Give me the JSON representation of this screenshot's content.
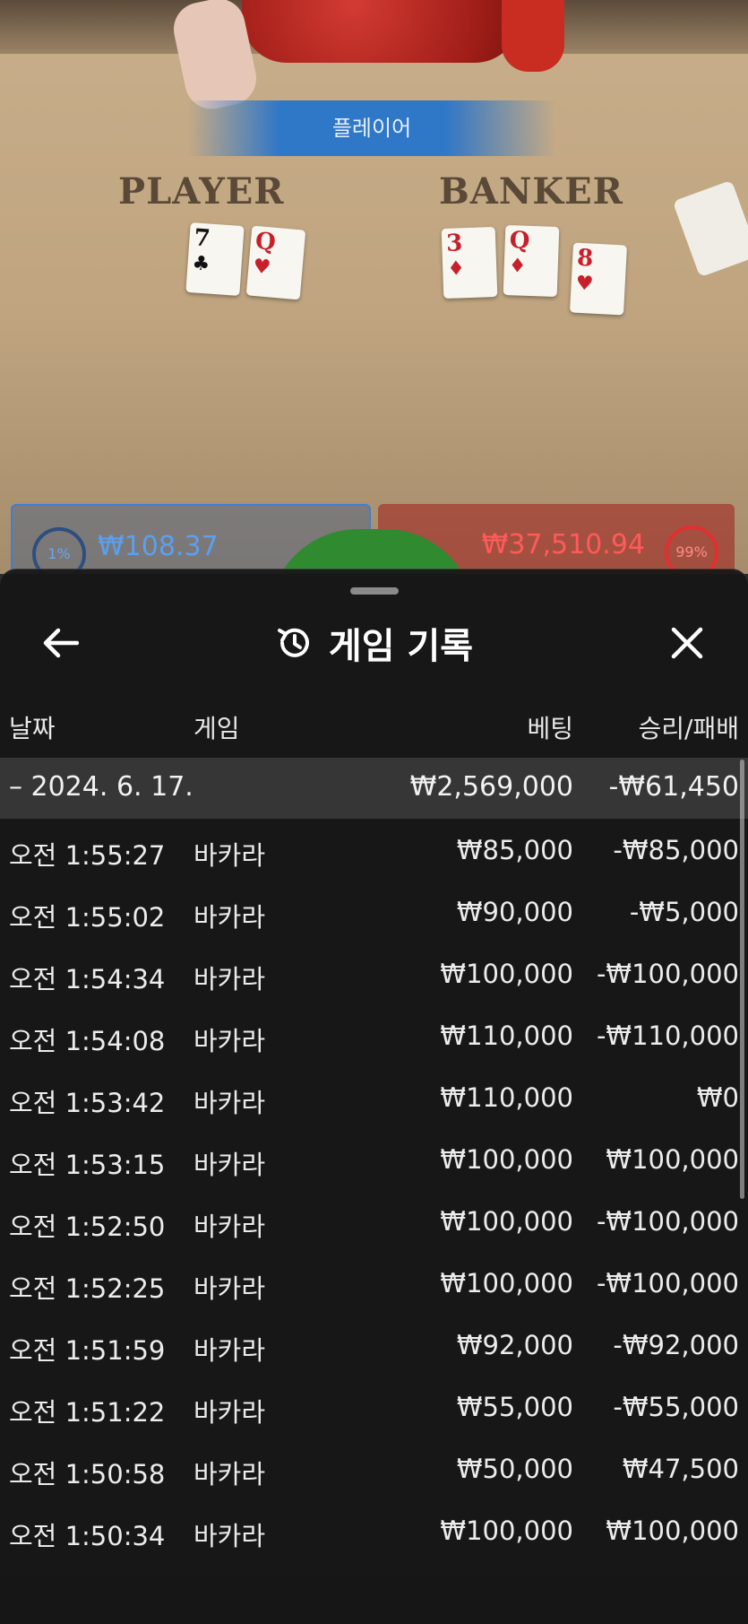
{
  "game_view": {
    "announcement": "플레이어",
    "player_label": "PLAYER",
    "banker_label": "BANKER",
    "player_cards": [
      {
        "rank": "7",
        "suit": "♣",
        "color": "black"
      },
      {
        "rank": "Q",
        "suit": "♥",
        "color": "red"
      }
    ],
    "banker_cards": [
      {
        "rank": "3",
        "suit": "♦",
        "color": "red"
      },
      {
        "rank": "Q",
        "suit": "♦",
        "color": "red"
      },
      {
        "rank": "8",
        "suit": "♥",
        "color": "red"
      }
    ],
    "player_bet": {
      "percent": "1%",
      "amount": "₩108.37"
    },
    "banker_bet": {
      "percent": "99%",
      "amount": "₩37,510.94"
    }
  },
  "history": {
    "title": "게임 기록",
    "headers": {
      "date": "날짜",
      "game": "게임",
      "bet": "베팅",
      "result": "승리/패배"
    },
    "summary": {
      "date": "– 2024. 6. 17.",
      "bet": "₩2,569,000",
      "result": "-₩61,450"
    },
    "rows": [
      {
        "time": "오전 1:55:27",
        "game": "바카라",
        "bet": "₩85,000",
        "result": "-₩85,000"
      },
      {
        "time": "오전 1:55:02",
        "game": "바카라",
        "bet": "₩90,000",
        "result": "-₩5,000"
      },
      {
        "time": "오전 1:54:34",
        "game": "바카라",
        "bet": "₩100,000",
        "result": "-₩100,000"
      },
      {
        "time": "오전 1:54:08",
        "game": "바카라",
        "bet": "₩110,000",
        "result": "-₩110,000"
      },
      {
        "time": "오전 1:53:42",
        "game": "바카라",
        "bet": "₩110,000",
        "result": "₩0"
      },
      {
        "time": "오전 1:53:15",
        "game": "바카라",
        "bet": "₩100,000",
        "result": "₩100,000"
      },
      {
        "time": "오전 1:52:50",
        "game": "바카라",
        "bet": "₩100,000",
        "result": "-₩100,000"
      },
      {
        "time": "오전 1:52:25",
        "game": "바카라",
        "bet": "₩100,000",
        "result": "-₩100,000"
      },
      {
        "time": "오전 1:51:59",
        "game": "바카라",
        "bet": "₩92,000",
        "result": "-₩92,000"
      },
      {
        "time": "오전 1:51:22",
        "game": "바카라",
        "bet": "₩55,000",
        "result": "-₩55,000"
      },
      {
        "time": "오전 1:50:58",
        "game": "바카라",
        "bet": "₩50,000",
        "result": "₩47,500"
      },
      {
        "time": "오전 1:50:34",
        "game": "바카라",
        "bet": "₩100,000",
        "result": "₩100,000"
      }
    ]
  },
  "icons": {
    "back": "arrow-left-icon",
    "history": "history-clock-icon",
    "close": "close-icon"
  },
  "colors": {
    "player_blue": "#3d7fd6",
    "banker_red": "#e03030",
    "sheet_bg": "#161616"
  }
}
